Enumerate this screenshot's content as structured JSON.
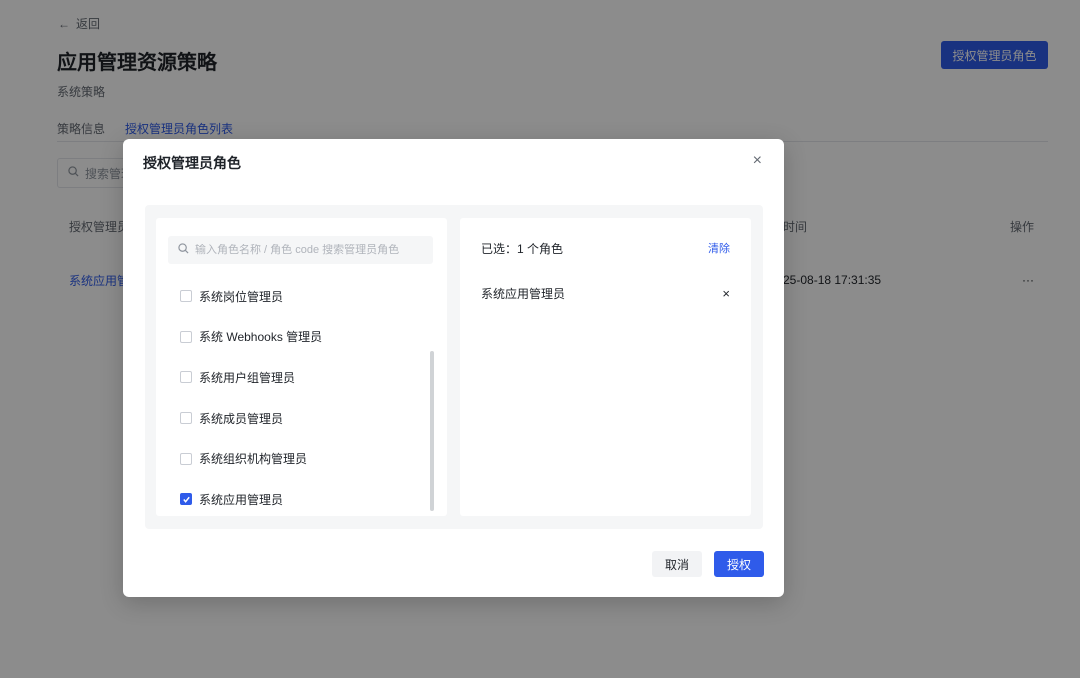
{
  "background": {
    "back_label": "返回",
    "page_title": "应用管理资源策略",
    "page_subtitle": "系统策略",
    "top_button_label": "授权管理员角色",
    "tabs": [
      {
        "label": "策略信息",
        "active": false
      },
      {
        "label": "授权管理员角色列表",
        "active": true
      }
    ],
    "search_placeholder": "搜索管理",
    "table": {
      "headers": [
        "授权管理员",
        "时间",
        "操作"
      ],
      "rows": [
        {
          "name": "系统应用管",
          "time": "25-08-18 17:31:35",
          "actions": "···"
        }
      ]
    }
  },
  "modal": {
    "title": "授权管理员角色",
    "close_label": "×",
    "search_placeholder": "输入角色名称 / 角色 code 搜索管理员角色",
    "roles": [
      {
        "label": "系统岗位管理员",
        "checked": false
      },
      {
        "label": "系统 Webhooks 管理员",
        "checked": false
      },
      {
        "label": "系统用户组管理员",
        "checked": false
      },
      {
        "label": "系统成员管理员",
        "checked": false
      },
      {
        "label": "系统组织机构管理员",
        "checked": false
      },
      {
        "label": "系统应用管理员",
        "checked": true
      }
    ],
    "selected_count_label": "已选：1 个角色",
    "clear_label": "清除",
    "selected_items": [
      {
        "label": "系统应用管理员",
        "remove_label": "×"
      }
    ],
    "cancel_label": "取消",
    "confirm_label": "授权"
  },
  "colors": {
    "accent": "#2f5bea",
    "overlay": "rgba(0,0,0,0.45)"
  }
}
